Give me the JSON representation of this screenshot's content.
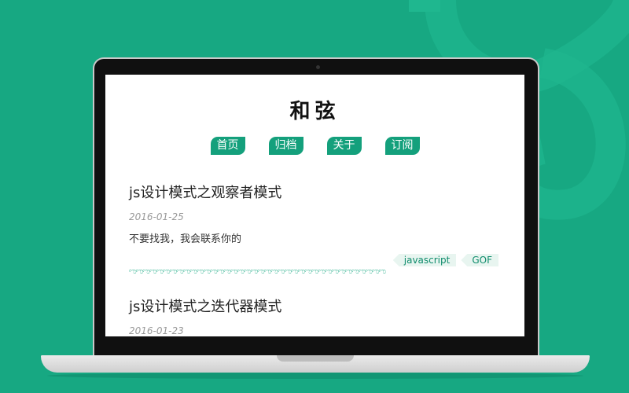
{
  "site": {
    "title": "和弦"
  },
  "nav": [
    {
      "label": "首页"
    },
    {
      "label": "归档"
    },
    {
      "label": "关于"
    },
    {
      "label": "订阅"
    }
  ],
  "posts": [
    {
      "title": "js设计模式之观察者模式",
      "date": "2016-01-25",
      "excerpt": "不要找我，我会联系你的",
      "tags": [
        "javascript",
        "GOF"
      ]
    },
    {
      "title": "js设计模式之迭代器模式",
      "date": "2016-01-23"
    }
  ],
  "divider": {
    "glyph": "ಌಌಌಌಌಌಌಌಌಌಌಌಌಌಌಌಌಌಌಌಌಌಌಌಌಌಌಌಌಌಌಌಌಌಌಌಌಌ"
  },
  "colors": {
    "background": "#17a882",
    "accent": "#14a07c",
    "tag_bg": "#e8f5f0"
  }
}
